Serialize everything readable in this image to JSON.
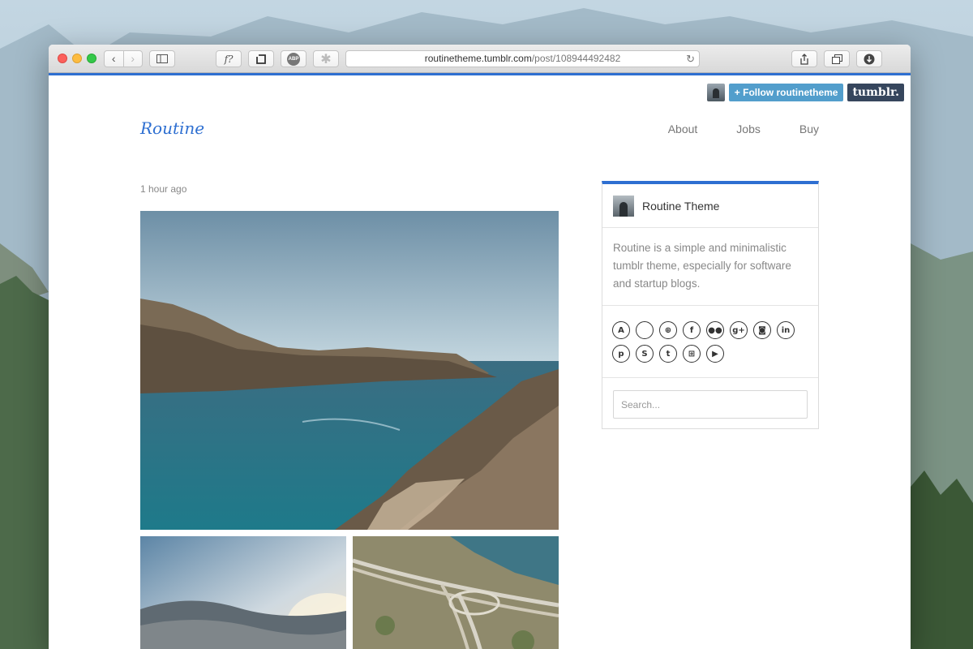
{
  "browser": {
    "url_host": "routinetheme.tumblr.com",
    "url_path": "/post/108944492482",
    "reload_glyph": "↻",
    "back_glyph": "‹",
    "forward_glyph": "›",
    "font_btn_label": "f?",
    "abp_label": "ABP"
  },
  "tumblr": {
    "follow_label": "+ Follow routinetheme",
    "logo_text": "tumblr."
  },
  "site": {
    "title": "Routine",
    "nav": [
      "About",
      "Jobs",
      "Buy"
    ]
  },
  "post": {
    "time": "1 hour ago"
  },
  "sidebar": {
    "name": "Routine Theme",
    "description": "Routine is a simple and minimalistic tumblr theme, especially for software and startup blogs.",
    "search_placeholder": "Search...",
    "social_icons": [
      {
        "name": "android-icon",
        "glyph": "A"
      },
      {
        "name": "apple-icon",
        "glyph": ""
      },
      {
        "name": "dribbble-icon",
        "glyph": "⊕"
      },
      {
        "name": "facebook-icon",
        "glyph": "f"
      },
      {
        "name": "flickr-icon",
        "glyph": "●●"
      },
      {
        "name": "google-plus-icon",
        "glyph": "g+"
      },
      {
        "name": "instagram-icon",
        "glyph": "◙"
      },
      {
        "name": "linkedin-icon",
        "glyph": "in"
      },
      {
        "name": "pinterest-icon",
        "glyph": "p"
      },
      {
        "name": "skype-icon",
        "glyph": "S"
      },
      {
        "name": "twitter-icon",
        "glyph": "t"
      },
      {
        "name": "windows-icon",
        "glyph": "⊞"
      },
      {
        "name": "youtube-icon",
        "glyph": "▶"
      }
    ]
  },
  "colors": {
    "accent": "#2e6fd1",
    "follow": "#529ecc",
    "tumblr_navy": "#36465d"
  }
}
